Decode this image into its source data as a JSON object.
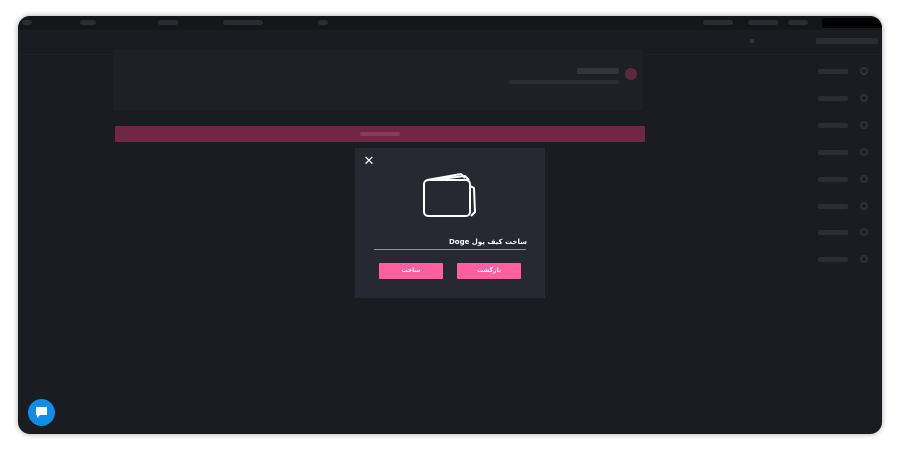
{
  "modal": {
    "close_symbol": "✕",
    "icon": "wallet-icon",
    "title": "ساخت کیف پول Doge",
    "create_label": "ساخت",
    "back_label": "بازگشت"
  },
  "chat": {
    "icon": "chat-bubble-icon"
  },
  "colors": {
    "background": "#1b1c21",
    "modal_background": "#262832",
    "accent": "#ff5fa0",
    "chat_button": "#0f8de8"
  }
}
